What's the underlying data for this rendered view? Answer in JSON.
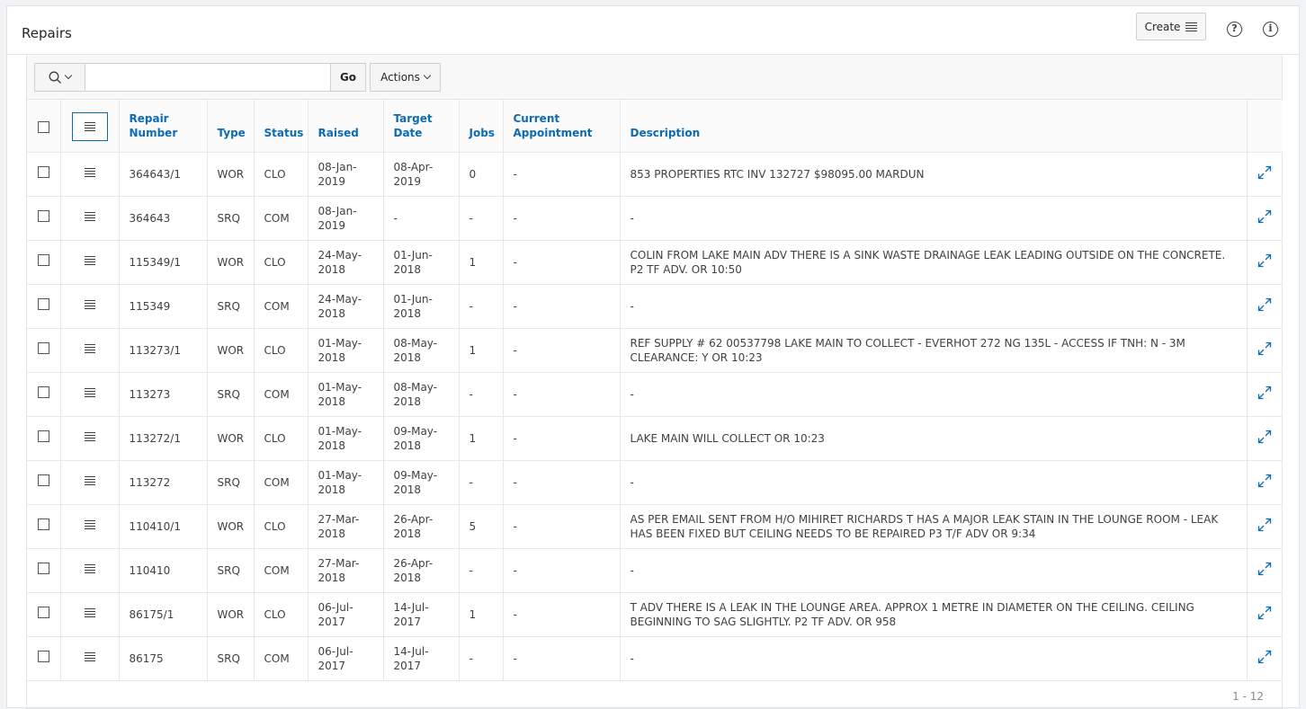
{
  "region": {
    "title": "Repairs",
    "create_label": "Create",
    "help_icon": "help-icon",
    "info_icon": "info-icon"
  },
  "toolbar": {
    "search_placeholder": "",
    "go_label": "Go",
    "actions_label": "Actions"
  },
  "columns": [
    "Repair Number",
    "Type",
    "Status",
    "Raised",
    "Target Date",
    "Jobs",
    "Current Appointment",
    "Description"
  ],
  "rows": [
    {
      "repair_number": "364643/1",
      "type": "WOR",
      "status": "CLO",
      "raised": "08-Jan-2019",
      "target_date": "08-Apr-2019",
      "jobs": "0",
      "appointment": "-",
      "description": "853 PROPERTIES RTC INV 132727 $98095.00 MARDUN"
    },
    {
      "repair_number": "364643",
      "type": "SRQ",
      "status": "COM",
      "raised": "08-Jan-2019",
      "target_date": "-",
      "jobs": "-",
      "appointment": "-",
      "description": "-"
    },
    {
      "repair_number": "115349/1",
      "type": "WOR",
      "status": "CLO",
      "raised": "24-May-2018",
      "target_date": "01-Jun-2018",
      "jobs": "1",
      "appointment": "-",
      "description": "COLIN FROM LAKE MAIN ADV THERE IS A SINK WASTE DRAINAGE LEAK LEADING OUTSIDE ON THE CONCRETE. P2 TF ADV. OR 10:50"
    },
    {
      "repair_number": "115349",
      "type": "SRQ",
      "status": "COM",
      "raised": "24-May-2018",
      "target_date": "01-Jun-2018",
      "jobs": "-",
      "appointment": "-",
      "description": "-"
    },
    {
      "repair_number": "113273/1",
      "type": "WOR",
      "status": "CLO",
      "raised": "01-May-2018",
      "target_date": "08-May-2018",
      "jobs": "1",
      "appointment": "-",
      "description": "REF SUPPLY # 62 00537798 LAKE MAIN TO COLLECT - EVERHOT 272 NG 135L - ACCESS IF TNH: N - 3M CLEARANCE: Y OR 10:23"
    },
    {
      "repair_number": "113273",
      "type": "SRQ",
      "status": "COM",
      "raised": "01-May-2018",
      "target_date": "08-May-2018",
      "jobs": "-",
      "appointment": "-",
      "description": "-"
    },
    {
      "repair_number": "113272/1",
      "type": "WOR",
      "status": "CLO",
      "raised": "01-May-2018",
      "target_date": "09-May-2018",
      "jobs": "1",
      "appointment": "-",
      "description": "LAKE MAIN WILL COLLECT OR 10:23"
    },
    {
      "repair_number": "113272",
      "type": "SRQ",
      "status": "COM",
      "raised": "01-May-2018",
      "target_date": "09-May-2018",
      "jobs": "-",
      "appointment": "-",
      "description": "-"
    },
    {
      "repair_number": "110410/1",
      "type": "WOR",
      "status": "CLO",
      "raised": "27-Mar-2018",
      "target_date": "26-Apr-2018",
      "jobs": "5",
      "appointment": "-",
      "description": "AS PER EMAIL SENT FROM H/O MIHIRET RICHARDS T HAS A MAJOR LEAK STAIN IN THE LOUNGE ROOM - LEAK HAS BEEN FIXED BUT CEILING NEEDS TO BE REPAIRED P3 T/F ADV OR 9:34"
    },
    {
      "repair_number": "110410",
      "type": "SRQ",
      "status": "COM",
      "raised": "27-Mar-2018",
      "target_date": "26-Apr-2018",
      "jobs": "-",
      "appointment": "-",
      "description": "-"
    },
    {
      "repair_number": "86175/1",
      "type": "WOR",
      "status": "CLO",
      "raised": "06-Jul-2017",
      "target_date": "14-Jul-2017",
      "jobs": "1",
      "appointment": "-",
      "description": "T ADV THERE IS A LEAK IN THE LOUNGE AREA. APPROX 1 METRE IN DIAMETER ON THE CEILING. CEILING BEGINNING TO SAG SLIGHTLY. P2 TF ADV. OR 958"
    },
    {
      "repair_number": "86175",
      "type": "SRQ",
      "status": "COM",
      "raised": "06-Jul-2017",
      "target_date": "14-Jul-2017",
      "jobs": "-",
      "appointment": "-",
      "description": "-"
    }
  ],
  "pagination": {
    "range": "1 - 12"
  },
  "colors": {
    "link": "#0b6bb5",
    "text": "#404040",
    "border": "#e8e8e8",
    "background": "#f1f3f5"
  }
}
